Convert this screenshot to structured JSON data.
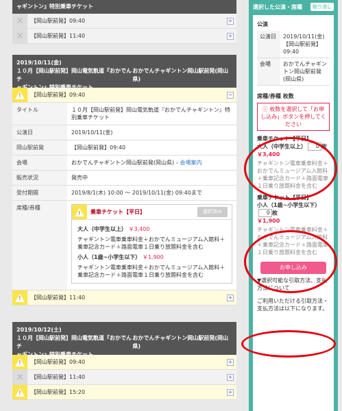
{
  "top_block": {
    "header_line": "ャギントン』特別乗車チケット",
    "rows": [
      {
        "label": "【岡山駅前発】09:40"
      },
      {
        "label": "【岡山駅前発】11:40"
      }
    ]
  },
  "event1": {
    "date": "2019/10/11(金)",
    "venue": "おかでんチャギントン岡山駅前発(岡山県)",
    "title_line1": "１０月【岡山駅前発】岡山電気軌道『おかでんチ",
    "title_line2": "ャギントン』特別乗車チケット",
    "selected_row": "【岡山駅前発】09:40",
    "details": {
      "title_label": "タイトル",
      "title_value": "１０月【岡山駅前発】岡山電気軌道『おかでんチャギントン』特別乗車チケット",
      "date_label": "公演日",
      "date_value": "2019/10/11(金)",
      "dep_label": "岡山駅前発",
      "dep_value": "【岡山駅前発】09:40",
      "venue_label": "会場",
      "venue_value": "おかでんチャギントン岡山駅前発(岡山県)",
      "venue_link": "会場案内",
      "status_label": "販売状況",
      "status_value": "発売中",
      "period_label": "受付期間",
      "period_value": "2019/8/1(木) 10:00 〜 2019/10/11(金) 09:40まで",
      "seat_label": "席種/券種"
    },
    "ticket": {
      "name": "乗車チケット【平日】",
      "selected_btn": "選択済み",
      "adult_label": "大人（中学生以上）",
      "adult_price": "￥3,400",
      "adult_desc": "チャギントン電車乗車料金＋おかでんミュージアム入館料＋乗車記念カード＋路面電車１日乗り放題料金を含む",
      "child_label": "小人（1歳~小学生以下）",
      "child_price": "￥1,900",
      "child_desc": "チャギントン電車乗車料金＋おかでんミュージアム入館料＋乗車記念カード＋路面電車１日乗り放題料金を含む"
    },
    "next_row": "【岡山駅前発】11:40"
  },
  "event2": {
    "date": "2019/10/12(土)",
    "venue": "おかでんチャギントン岡山駅前発(岡山県)",
    "title_line1": "１０月【岡山駅前発】岡山電気軌道『おかでんチ",
    "title_line2": "ャギントン』特別乗車チケット",
    "rows": [
      {
        "label": "【岡山駅前発】09:40"
      },
      {
        "label": "【岡山駅前発】11:40"
      },
      {
        "label": "【岡山駅前発】15:20"
      }
    ]
  },
  "sidebar": {
    "title": "選択した公演・席種",
    "clear_btn": "取り消し",
    "perf_heading": "公演",
    "perf_date_label": "公演日",
    "perf_date_value": "2019/10/11(金)【岡山駅前発】09:40",
    "perf_venue_label": "会場",
    "perf_venue_value": "おかでんチャギントン岡山駅前発(岡山県)",
    "seat_heading": "席種/券種 枚数",
    "notice": "枚数を選択して「お申し込み」ボタンを押してください",
    "ticket1": {
      "name": "乗車チケット【平日】",
      "type": "大人（中学生以上）",
      "price": "￥3,400",
      "qty": "0",
      "unit": "枚",
      "desc": "チャギントン電車乗車料金＋おかでんミュージアム入館料＋乗車記念カード＋路面電車１日乗り放題料金を含む"
    },
    "ticket2": {
      "name": "乗車チケット【平日】",
      "type": "小人（1歳~小学生以下）",
      "price": "￥1,900",
      "qty": "0",
      "unit": "枚",
      "desc": "チャギントン電車乗車料金＋おかでんミュージアム入館料＋乗車記念カード＋路面電車１日乗り放題料金を含む"
    },
    "apply_btn": "お申し込み",
    "footer1": "▼選択可能な引取方法、支払方法について",
    "footer2": "ご利用いただける引取方法・支払方法は以下になります。"
  },
  "colors": {
    "accent": "#4ab3a4",
    "highlight_red": "#e3000f",
    "price": "#e0254b",
    "apply": "#f05a8c",
    "warning_yellow": "#fbe44a"
  }
}
